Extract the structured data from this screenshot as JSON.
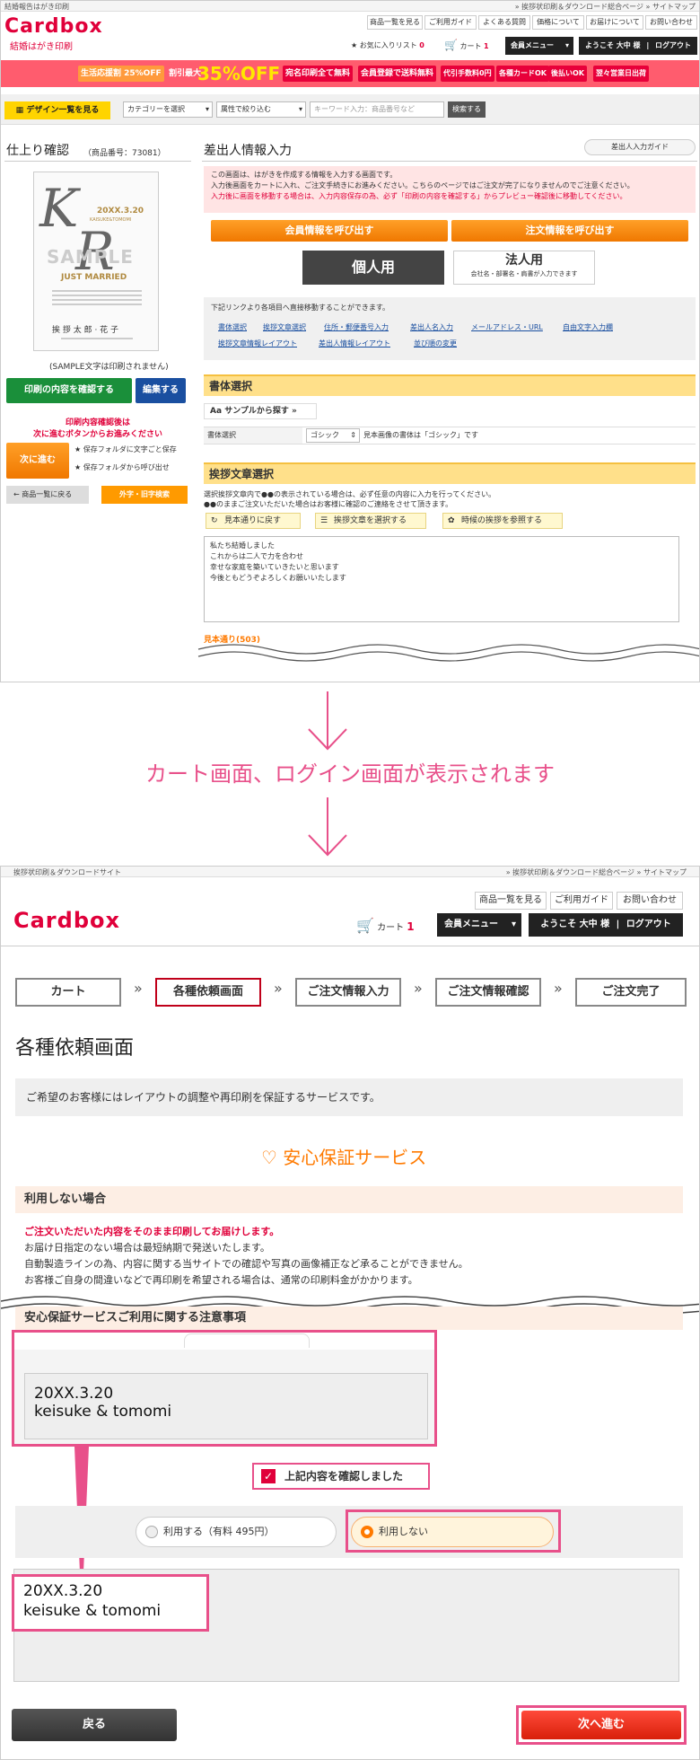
{
  "shot1": {
    "topbar_left": "結婚報告はがき印刷",
    "topbar_right": "» 挨拶状印刷＆ダウンロード総合ページ  » サイトマップ",
    "logo": "Cardbox",
    "logo_sub": "結婚はがき印刷",
    "nav": [
      "商品一覧を見る",
      "ご利用ガイド",
      "よくある質問",
      "価格について",
      "お届けについて",
      "お問い合わせ"
    ],
    "favorites_label": "お気に入りリスト",
    "favorites_count": "0",
    "cart_label": "カート",
    "cart_count": "1",
    "member_menu": "会員メニュー",
    "welcome": "ようこそ 大中 様",
    "logout": "ログアウト",
    "promo": {
      "tag1": "生活応援割 25%OFF",
      "tag2": "割引最大",
      "big": "35%OFF",
      "tag3": "宛名印刷全て無料",
      "tag4": "会員登録で送料無料",
      "tag5": "代引手数料0円",
      "tag6": "各種カードOK",
      "tag7": "後払いOK",
      "tag8": "翌々営業日出荷"
    },
    "design_btn": "デザイン一覧を見る",
    "category_select": "カテゴリーを選択",
    "attribute_select": "属性で絞り込む",
    "keyword_placeholder": "キーワード入力：商品番号など",
    "search_btn": "検索する",
    "finish_title": "仕上り確認",
    "product_no": "（商品番号：73081）",
    "card_date": "20XX.3.20",
    "card_names": "KAISUKE&TOMOMI",
    "card_sample": "SAMPLE",
    "card_just": "JUST MARRIED",
    "card_couple": "挨 拶 太 郎 · 花 子",
    "sample_note": "(SAMPLE文字は印刷されません)",
    "confirm_print_btn": "印刷の内容を確認する",
    "edit_btn": "編集する",
    "after_confirm_note1": "印刷内容確認後は",
    "after_confirm_note2": "次に進むボタンからお進みください",
    "next_btn": "次に進む",
    "save_folder1": "保存フォルダに文字ごと保存",
    "save_folder2": "保存フォルダから呼び出せ",
    "back_list_btn": "商品一覧に戻る",
    "gaiji_btn": "外字・旧字検索",
    "sender_title": "差出人情報入力",
    "sender_guide_btn": "差出人入力ガイド",
    "notice1": "この画面は、はがきを作成する情報を入力する画面です。",
    "notice2": "入力後画面をカートに入れ、ご注文手続きにお進みください。こちらのページではご注文が完了になりませんのでご注意ください。",
    "notice3": "入力後に画面を移動する場合は、入力内容保存の為、必ず「印刷の内容を確認する」からプレビュー確認後に移動してください。",
    "member_call_btn": "会員情報を呼び出す",
    "order_call_btn": "注文情報を呼び出す",
    "tab_personal": "個人用",
    "tab_corporate": "法人用",
    "tab_corporate_sub": "会社名・部署名・肩書が入力できます",
    "direct_link_note": "下記リンクより各項目へ直接移動することができます。",
    "links_row1": [
      "書体選択",
      "挨拶文章選択",
      "住所・郵便番号入力",
      "差出人名入力",
      "メールアドレス・URL",
      "自由文字入力欄"
    ],
    "links_row2": [
      "挨拶文章情報レイアウト",
      "差出人情報レイアウト",
      "並び順の変更"
    ],
    "font_section": "書体選択",
    "sample_search_btn": "サンプルから探す »",
    "font_label": "書体選択",
    "font_value": "ゴシック",
    "font_note": "見本画像の書体は「ゴシック」です",
    "greeting_section": "挨拶文章選択",
    "greeting_note1": "選択挨拶文章内で●●の表示されている場合は、必ず任意の内容に入力を行ってください。",
    "greeting_note2": "●●のままご注文いただいた場合はお客様に確認のご連絡をさせて頂きます。",
    "restore_btn": "見本通りに戻す",
    "select_greeting_btn": "挨拶文章を選択する",
    "season_btn": "時候の挨拶を参照する",
    "greeting_lines": [
      "私たち結婚しました",
      "これからは二人で力を合わせ",
      "幸せな家庭を築いていきたいと思います",
      "今後ともどうぞよろしくお願いいたします"
    ],
    "sample_count": "見本通り(503)"
  },
  "middle_text": "カート画面、ログイン画面が表示されます",
  "shot2": {
    "topbar_left": "挨拶状印刷＆ダウンロードサイト",
    "topbar_right": "» 挨拶状印刷＆ダウンロード総合ページ  » サイトマップ",
    "nav": [
      "商品一覧を見る",
      "ご利用ガイド",
      "お問い合わせ"
    ],
    "logo": "Cardbox",
    "cart_label": "カート",
    "cart_count": "1",
    "member_menu": "会員メニュー",
    "welcome": "ようこそ 大中 様",
    "logout": "ログアウト",
    "steps": [
      "カート",
      "各種依頼画面",
      "ご注文情報入力",
      "ご注文情報確認",
      "ご注文完了"
    ],
    "page_title": "各種依頼画面",
    "intro": "ご希望のお客様にはレイアウトの調整や再印刷を保証するサービスです。",
    "service_title": "安心保証サービス",
    "not_use_title": "利用しない場合",
    "not_use_red": "ご注文いただいた内容をそのまま印刷してお届けします。",
    "not_use_1": "お届け日指定のない場合は最短納期で発送いたします。",
    "not_use_2": "自動製造ラインの為、内容に関する当サイトでの確認や写真の画像補正など承ることができません。",
    "not_use_3": "お客様ご自身の間違いなどで再印刷を希望される場合は、通常の印刷料金がかかります。",
    "notice_title": "安心保証サービスご利用に関する注意事項",
    "sample_date": "20XX.3.20",
    "sample_names": "keisuke & tomomi",
    "confirm_check": "上記内容を確認しました",
    "use_option": "利用する（有料 495円）",
    "not_use_option": "利用しない",
    "back_btn": "戻る",
    "next_btn": "次へ進む"
  }
}
